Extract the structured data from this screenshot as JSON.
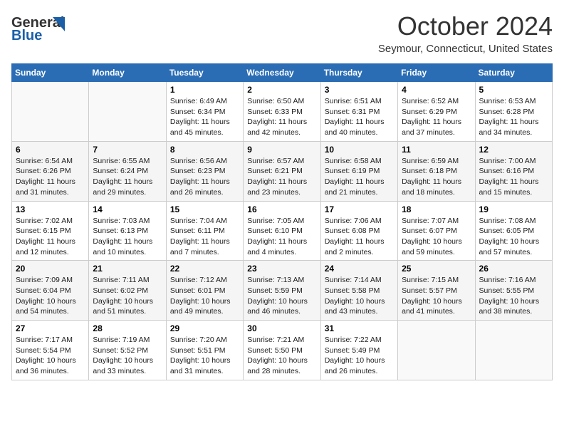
{
  "header": {
    "logo_line1": "General",
    "logo_line2": "Blue",
    "month": "October 2024",
    "location": "Seymour, Connecticut, United States"
  },
  "weekdays": [
    "Sunday",
    "Monday",
    "Tuesday",
    "Wednesday",
    "Thursday",
    "Friday",
    "Saturday"
  ],
  "weeks": [
    [
      {
        "day": "",
        "sunrise": "",
        "sunset": "",
        "daylight": ""
      },
      {
        "day": "",
        "sunrise": "",
        "sunset": "",
        "daylight": ""
      },
      {
        "day": "1",
        "sunrise": "Sunrise: 6:49 AM",
        "sunset": "Sunset: 6:34 PM",
        "daylight": "Daylight: 11 hours and 45 minutes."
      },
      {
        "day": "2",
        "sunrise": "Sunrise: 6:50 AM",
        "sunset": "Sunset: 6:33 PM",
        "daylight": "Daylight: 11 hours and 42 minutes."
      },
      {
        "day": "3",
        "sunrise": "Sunrise: 6:51 AM",
        "sunset": "Sunset: 6:31 PM",
        "daylight": "Daylight: 11 hours and 40 minutes."
      },
      {
        "day": "4",
        "sunrise": "Sunrise: 6:52 AM",
        "sunset": "Sunset: 6:29 PM",
        "daylight": "Daylight: 11 hours and 37 minutes."
      },
      {
        "day": "5",
        "sunrise": "Sunrise: 6:53 AM",
        "sunset": "Sunset: 6:28 PM",
        "daylight": "Daylight: 11 hours and 34 minutes."
      }
    ],
    [
      {
        "day": "6",
        "sunrise": "Sunrise: 6:54 AM",
        "sunset": "Sunset: 6:26 PM",
        "daylight": "Daylight: 11 hours and 31 minutes."
      },
      {
        "day": "7",
        "sunrise": "Sunrise: 6:55 AM",
        "sunset": "Sunset: 6:24 PM",
        "daylight": "Daylight: 11 hours and 29 minutes."
      },
      {
        "day": "8",
        "sunrise": "Sunrise: 6:56 AM",
        "sunset": "Sunset: 6:23 PM",
        "daylight": "Daylight: 11 hours and 26 minutes."
      },
      {
        "day": "9",
        "sunrise": "Sunrise: 6:57 AM",
        "sunset": "Sunset: 6:21 PM",
        "daylight": "Daylight: 11 hours and 23 minutes."
      },
      {
        "day": "10",
        "sunrise": "Sunrise: 6:58 AM",
        "sunset": "Sunset: 6:19 PM",
        "daylight": "Daylight: 11 hours and 21 minutes."
      },
      {
        "day": "11",
        "sunrise": "Sunrise: 6:59 AM",
        "sunset": "Sunset: 6:18 PM",
        "daylight": "Daylight: 11 hours and 18 minutes."
      },
      {
        "day": "12",
        "sunrise": "Sunrise: 7:00 AM",
        "sunset": "Sunset: 6:16 PM",
        "daylight": "Daylight: 11 hours and 15 minutes."
      }
    ],
    [
      {
        "day": "13",
        "sunrise": "Sunrise: 7:02 AM",
        "sunset": "Sunset: 6:15 PM",
        "daylight": "Daylight: 11 hours and 12 minutes."
      },
      {
        "day": "14",
        "sunrise": "Sunrise: 7:03 AM",
        "sunset": "Sunset: 6:13 PM",
        "daylight": "Daylight: 11 hours and 10 minutes."
      },
      {
        "day": "15",
        "sunrise": "Sunrise: 7:04 AM",
        "sunset": "Sunset: 6:11 PM",
        "daylight": "Daylight: 11 hours and 7 minutes."
      },
      {
        "day": "16",
        "sunrise": "Sunrise: 7:05 AM",
        "sunset": "Sunset: 6:10 PM",
        "daylight": "Daylight: 11 hours and 4 minutes."
      },
      {
        "day": "17",
        "sunrise": "Sunrise: 7:06 AM",
        "sunset": "Sunset: 6:08 PM",
        "daylight": "Daylight: 11 hours and 2 minutes."
      },
      {
        "day": "18",
        "sunrise": "Sunrise: 7:07 AM",
        "sunset": "Sunset: 6:07 PM",
        "daylight": "Daylight: 10 hours and 59 minutes."
      },
      {
        "day": "19",
        "sunrise": "Sunrise: 7:08 AM",
        "sunset": "Sunset: 6:05 PM",
        "daylight": "Daylight: 10 hours and 57 minutes."
      }
    ],
    [
      {
        "day": "20",
        "sunrise": "Sunrise: 7:09 AM",
        "sunset": "Sunset: 6:04 PM",
        "daylight": "Daylight: 10 hours and 54 minutes."
      },
      {
        "day": "21",
        "sunrise": "Sunrise: 7:11 AM",
        "sunset": "Sunset: 6:02 PM",
        "daylight": "Daylight: 10 hours and 51 minutes."
      },
      {
        "day": "22",
        "sunrise": "Sunrise: 7:12 AM",
        "sunset": "Sunset: 6:01 PM",
        "daylight": "Daylight: 10 hours and 49 minutes."
      },
      {
        "day": "23",
        "sunrise": "Sunrise: 7:13 AM",
        "sunset": "Sunset: 5:59 PM",
        "daylight": "Daylight: 10 hours and 46 minutes."
      },
      {
        "day": "24",
        "sunrise": "Sunrise: 7:14 AM",
        "sunset": "Sunset: 5:58 PM",
        "daylight": "Daylight: 10 hours and 43 minutes."
      },
      {
        "day": "25",
        "sunrise": "Sunrise: 7:15 AM",
        "sunset": "Sunset: 5:57 PM",
        "daylight": "Daylight: 10 hours and 41 minutes."
      },
      {
        "day": "26",
        "sunrise": "Sunrise: 7:16 AM",
        "sunset": "Sunset: 5:55 PM",
        "daylight": "Daylight: 10 hours and 38 minutes."
      }
    ],
    [
      {
        "day": "27",
        "sunrise": "Sunrise: 7:17 AM",
        "sunset": "Sunset: 5:54 PM",
        "daylight": "Daylight: 10 hours and 36 minutes."
      },
      {
        "day": "28",
        "sunrise": "Sunrise: 7:19 AM",
        "sunset": "Sunset: 5:52 PM",
        "daylight": "Daylight: 10 hours and 33 minutes."
      },
      {
        "day": "29",
        "sunrise": "Sunrise: 7:20 AM",
        "sunset": "Sunset: 5:51 PM",
        "daylight": "Daylight: 10 hours and 31 minutes."
      },
      {
        "day": "30",
        "sunrise": "Sunrise: 7:21 AM",
        "sunset": "Sunset: 5:50 PM",
        "daylight": "Daylight: 10 hours and 28 minutes."
      },
      {
        "day": "31",
        "sunrise": "Sunrise: 7:22 AM",
        "sunset": "Sunset: 5:49 PM",
        "daylight": "Daylight: 10 hours and 26 minutes."
      },
      {
        "day": "",
        "sunrise": "",
        "sunset": "",
        "daylight": ""
      },
      {
        "day": "",
        "sunrise": "",
        "sunset": "",
        "daylight": ""
      }
    ]
  ]
}
